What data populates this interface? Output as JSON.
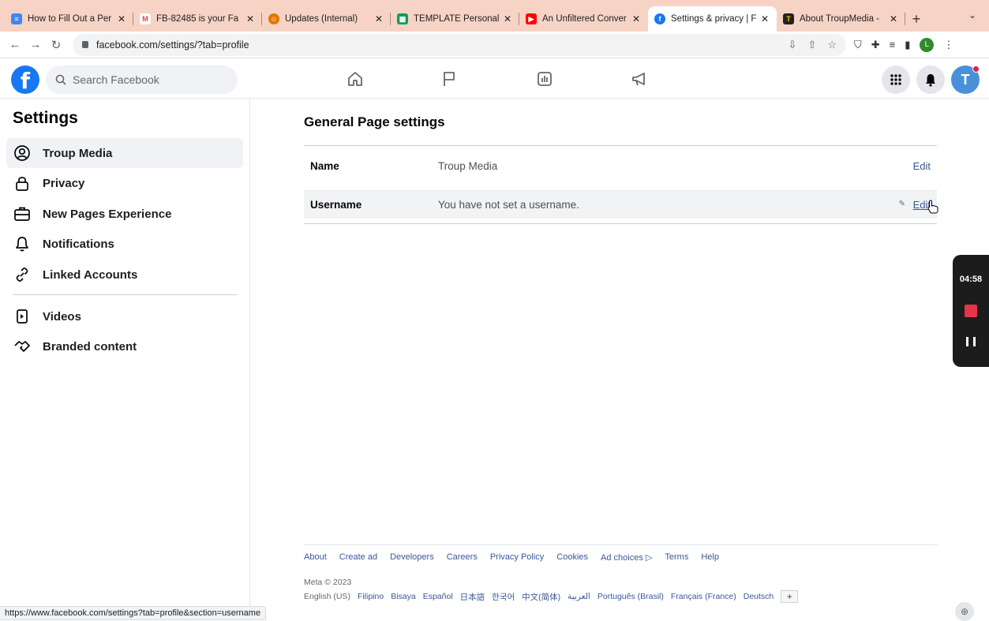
{
  "browser": {
    "tabs": [
      {
        "title": "How to Fill Out a Per",
        "icon": "docs-icon",
        "color": "#4285f4"
      },
      {
        "title": "FB-82485 is your Fa",
        "icon": "gmail-icon",
        "color": "#ea4335"
      },
      {
        "title": "Updates (Internal)",
        "icon": "updates-icon",
        "color": "#e37400"
      },
      {
        "title": "TEMPLATE Personal",
        "icon": "sheets-icon",
        "color": "#0f9d58"
      },
      {
        "title": "An Unfiltered Conver",
        "icon": "youtube-icon",
        "color": "#ff0000"
      },
      {
        "title": "Settings & privacy | F",
        "icon": "facebook-icon",
        "color": "#1877f2"
      },
      {
        "title": "About TroupMedia -",
        "icon": "troupmedia-icon",
        "color": "#222222"
      }
    ],
    "url": "facebook.com/settings/?tab=profile",
    "profile_initial": "L",
    "status_url": "https://www.facebook.com/settings?tab=profile&section=username"
  },
  "fb": {
    "search_placeholder": "Search Facebook",
    "profile_initial": "T"
  },
  "sidebar": {
    "title": "Settings",
    "items": [
      {
        "label": "Troup Media",
        "icon": "profile-icon"
      },
      {
        "label": "Privacy",
        "icon": "lock-icon"
      },
      {
        "label": "New Pages Experience",
        "icon": "briefcase-icon"
      },
      {
        "label": "Notifications",
        "icon": "bell-icon"
      },
      {
        "label": "Linked Accounts",
        "icon": "link-icon"
      },
      {
        "label": "Videos",
        "icon": "video-icon"
      },
      {
        "label": "Branded content",
        "icon": "handshake-icon"
      }
    ]
  },
  "main": {
    "title": "General Page settings",
    "rows": [
      {
        "label": "Name",
        "value": "Troup Media",
        "action": "Edit"
      },
      {
        "label": "Username",
        "value": "You have not set a username.",
        "action": "Edit"
      }
    ]
  },
  "recorder": {
    "time": "04:58"
  },
  "footer": {
    "links": [
      "About",
      "Create ad",
      "Developers",
      "Careers",
      "Privacy Policy",
      "Cookies",
      "Ad choices",
      "Terms",
      "Help"
    ],
    "copyright": "Meta © 2023",
    "current_language": "English (US)",
    "languages": [
      "Filipino",
      "Bisaya",
      "Español",
      "日本語",
      "한국어",
      "中文(简体)",
      "العربية",
      "Português (Brasil)",
      "Français (France)",
      "Deutsch"
    ],
    "more": "+"
  },
  "colors": {
    "brand": "#1877f2",
    "link": "#385898",
    "stop": "#e8334a"
  }
}
